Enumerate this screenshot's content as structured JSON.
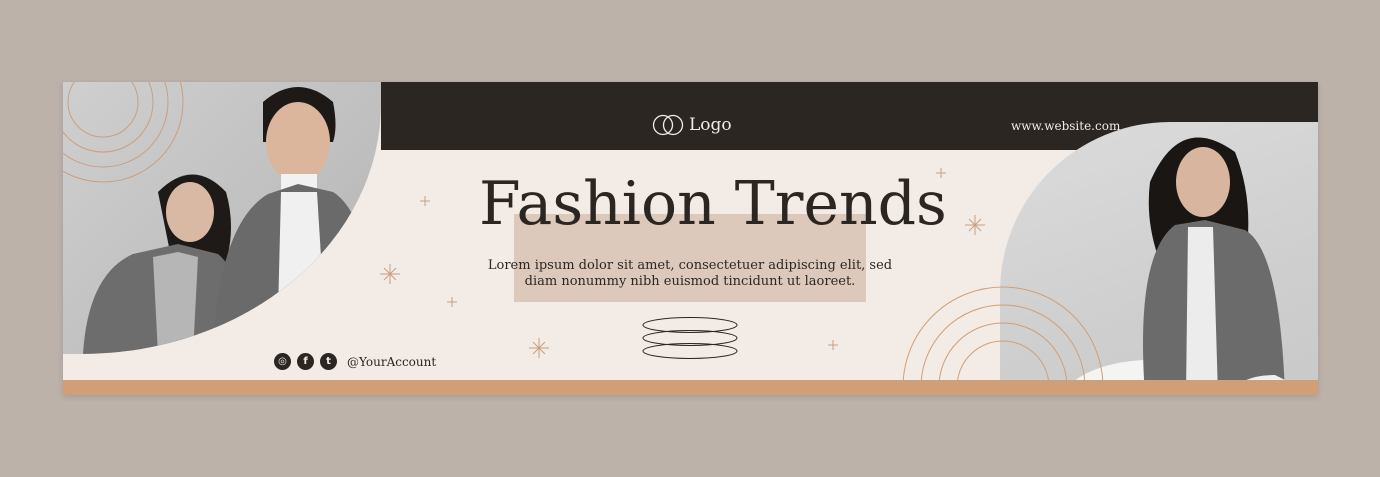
{
  "banner": {
    "logo_label": "Logo",
    "website": "www.website.com",
    "title": "Fashion Trends",
    "subtitle_line1": "Lorem ipsum dolor sit amet, consectetuer adipiscing elit, sed",
    "subtitle_line2": "diam nonummy nibh euismod tincidunt ut laoreet.",
    "account": "@YourAccount"
  },
  "social": [
    {
      "icon": "instagram-icon",
      "glyph": "◎"
    },
    {
      "icon": "facebook-icon",
      "glyph": "f"
    },
    {
      "icon": "twitter-icon",
      "glyph": "t"
    }
  ],
  "colors": {
    "background": "#bdb2aa",
    "cream": "#f3ebe5",
    "dark": "#2b2622",
    "accent": "#d19f77",
    "title_box": "#dcc9bc"
  }
}
